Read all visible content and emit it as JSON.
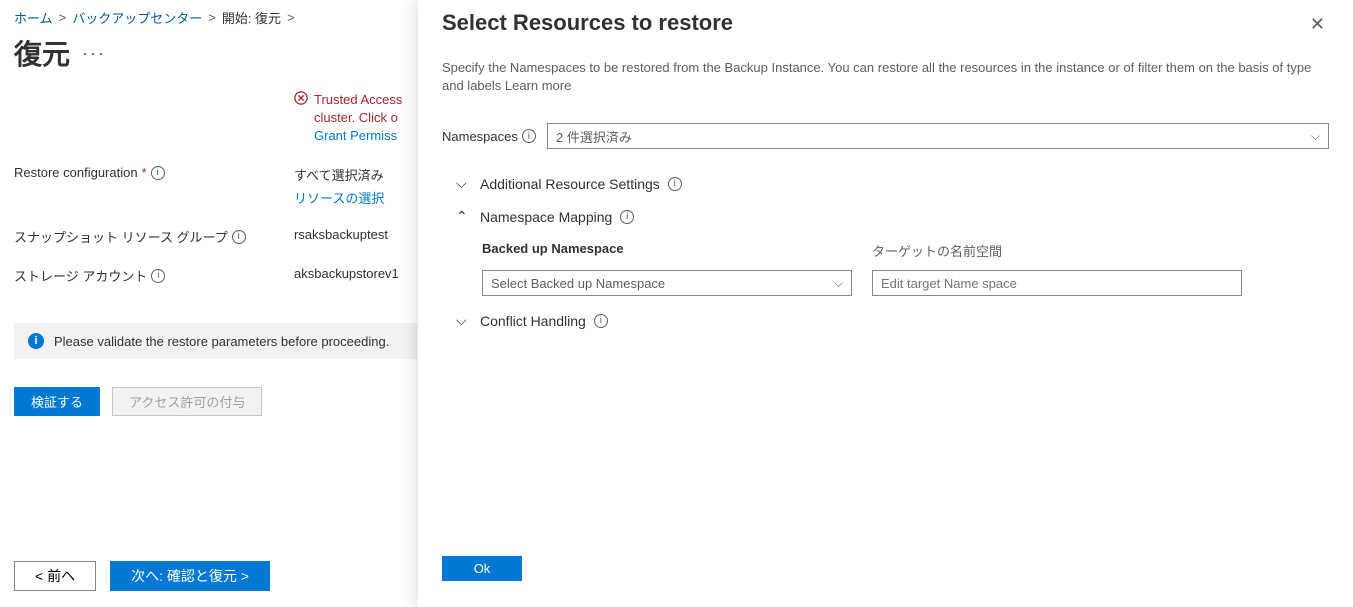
{
  "breadcrumb": {
    "home": "ホーム",
    "center": "バックアップセンター",
    "start": "開始: 復元"
  },
  "title": "復元",
  "error": {
    "line1": "Trusted Access",
    "line2": "cluster. Click o",
    "link": "Grant Permiss"
  },
  "restoreConfig": {
    "label": "Restore configuration",
    "value": "すべて選択済み",
    "link": "リソースの選択"
  },
  "snapshot": {
    "label": "スナップショット リソース グループ",
    "value": "rsaksbackuptest"
  },
  "storage": {
    "label": "ストレージ アカウント",
    "value": "aksbackupstorev1"
  },
  "banner": "Please validate the restore parameters before proceeding.",
  "buttons": {
    "validate": "検証する",
    "grant": "アクセス許可の付与",
    "prev": "< 前へ",
    "next": "次へ: 確認と復元 >"
  },
  "panel": {
    "title": "Select Resources to restore",
    "desc": "Specify the Namespaces to be restored from the Backup Instance. You can restore all the resources in the instance or of filter them on the basis of type and labels Learn more",
    "ns_label": "Namespaces",
    "ns_value": "2 件選択済み",
    "acc1": "Additional Resource Settings",
    "acc2": "Namespace Mapping",
    "acc3": "Conflict Handling",
    "backed_h": "Backed up Namespace",
    "target_h": "ターゲットの名前空間",
    "backed_ph": "Select Backed up Namespace",
    "target_ph": "Edit target Name space",
    "ok": "Ok"
  }
}
